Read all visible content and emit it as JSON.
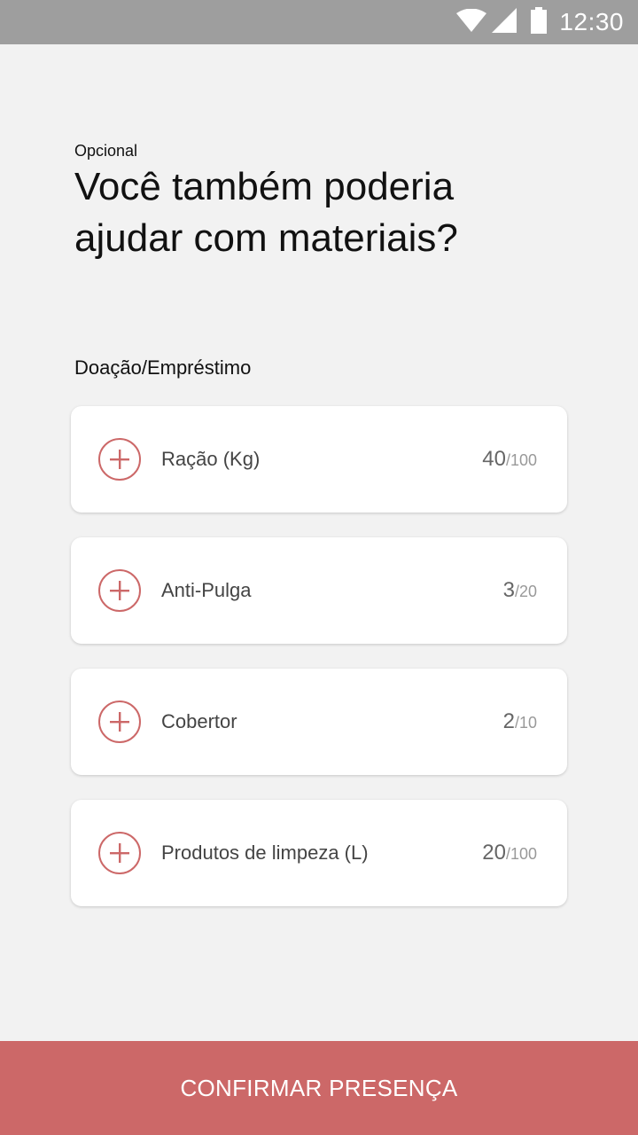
{
  "status_bar": {
    "time": "12:30",
    "icons": [
      "wifi-icon",
      "cellular-signal-icon",
      "battery-icon"
    ]
  },
  "header": {
    "optional_label": "Opcional",
    "title": "Você também poderia ajudar com materiais?"
  },
  "section": {
    "label": "Doação/Empréstimo"
  },
  "items": [
    {
      "label": "Ração (Kg)",
      "current": "40",
      "total": "/100",
      "icon": "plus-circle-icon"
    },
    {
      "label": "Anti-Pulga",
      "current": "3",
      "total": "/20",
      "icon": "plus-circle-icon"
    },
    {
      "label": "Cobertor",
      "current": "2",
      "total": "/10",
      "icon": "plus-circle-icon"
    },
    {
      "label": "Produtos de limpeza (L)",
      "current": "20",
      "total": "/100",
      "icon": "plus-circle-icon"
    }
  ],
  "footer": {
    "confirm_label": "CONFIRMAR PRESENÇA"
  },
  "colors": {
    "accent": "#cc6868",
    "status_bar": "#9e9e9e",
    "background": "#f2f2f2",
    "card": "#ffffff"
  }
}
